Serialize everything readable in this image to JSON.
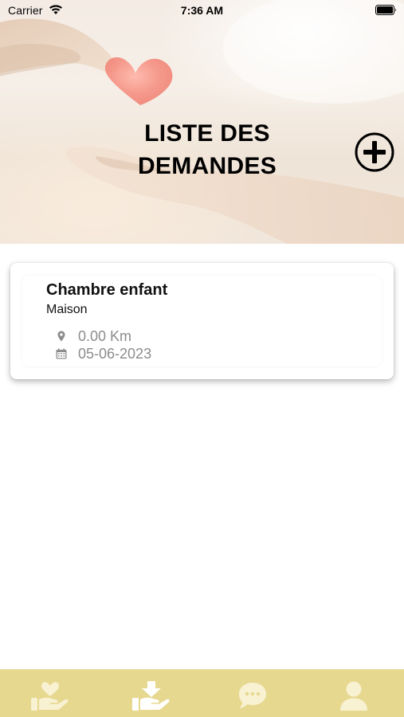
{
  "status_bar": {
    "carrier": "Carrier",
    "time": "7:36 AM"
  },
  "header": {
    "title_line1": "LISTE DES",
    "title_line2": "DEMANDES",
    "add_icon": "plus-circle-icon"
  },
  "requests": [
    {
      "title": "Chambre enfant",
      "category": "Maison",
      "distance": "0.00 Km",
      "date": "05-06-2023"
    }
  ],
  "tab_bar": {
    "background": "#e7d88f",
    "icon_color": "#f7f1d4",
    "active_icon_color": "#ffffff",
    "tabs": [
      {
        "icon": "heart-hand-icon"
      },
      {
        "icon": "download-hand-icon",
        "active": true
      },
      {
        "icon": "chat-bubble-icon"
      },
      {
        "icon": "user-icon"
      }
    ]
  }
}
